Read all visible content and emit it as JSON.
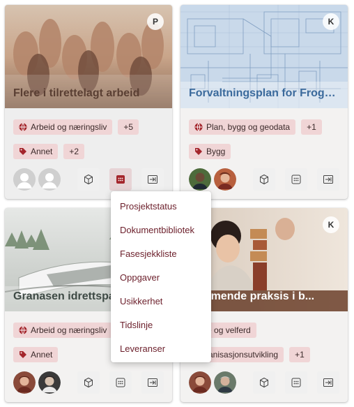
{
  "cards": [
    {
      "title": "Flere i tilrettelagt arbeid",
      "owner": "P",
      "tags_row1": [
        {
          "label": "Arbeid og næringsliv",
          "icon": "globe-icon"
        },
        {
          "label": "+5"
        }
      ],
      "tags_row2": [
        {
          "label": "Annet",
          "icon": "tag-icon"
        },
        {
          "label": "+2"
        }
      ]
    },
    {
      "title": "Forvaltningsplan for Frogne...",
      "owner": "K",
      "tags_row1": [
        {
          "label": "Plan, bygg og geodata",
          "icon": "globe-icon"
        },
        {
          "label": "+1"
        }
      ],
      "tags_row2": [
        {
          "label": "Bygg",
          "icon": "tag-icon"
        }
      ]
    },
    {
      "title": "Granasen idrettspar",
      "owner": "",
      "tags_row1": [
        {
          "label": "Arbeid og næringsliv",
          "icon": "globe-icon"
        }
      ],
      "tags_row2": [
        {
          "label": "Annet",
          "icon": "tag-icon"
        }
      ]
    },
    {
      "title": "efremmende praksis i b...",
      "owner": "K",
      "tags_row1": [
        {
          "label": "lelse og velferd"
        }
      ],
      "tags_row2": [
        {
          "label": "Organisasjonsutvikling"
        },
        {
          "label": "+1"
        }
      ]
    }
  ],
  "menu": {
    "items": [
      "Prosjektstatus",
      "Dokumentbibliotek",
      "Fasesjekkliste",
      "Oppgaver",
      "Usikkerhet",
      "Tidslinje",
      "Leveranser"
    ]
  },
  "colors": {
    "accent": "#a4262c",
    "tag_bg": "#f0d5d6",
    "menu_text": "#6b1e2a"
  }
}
